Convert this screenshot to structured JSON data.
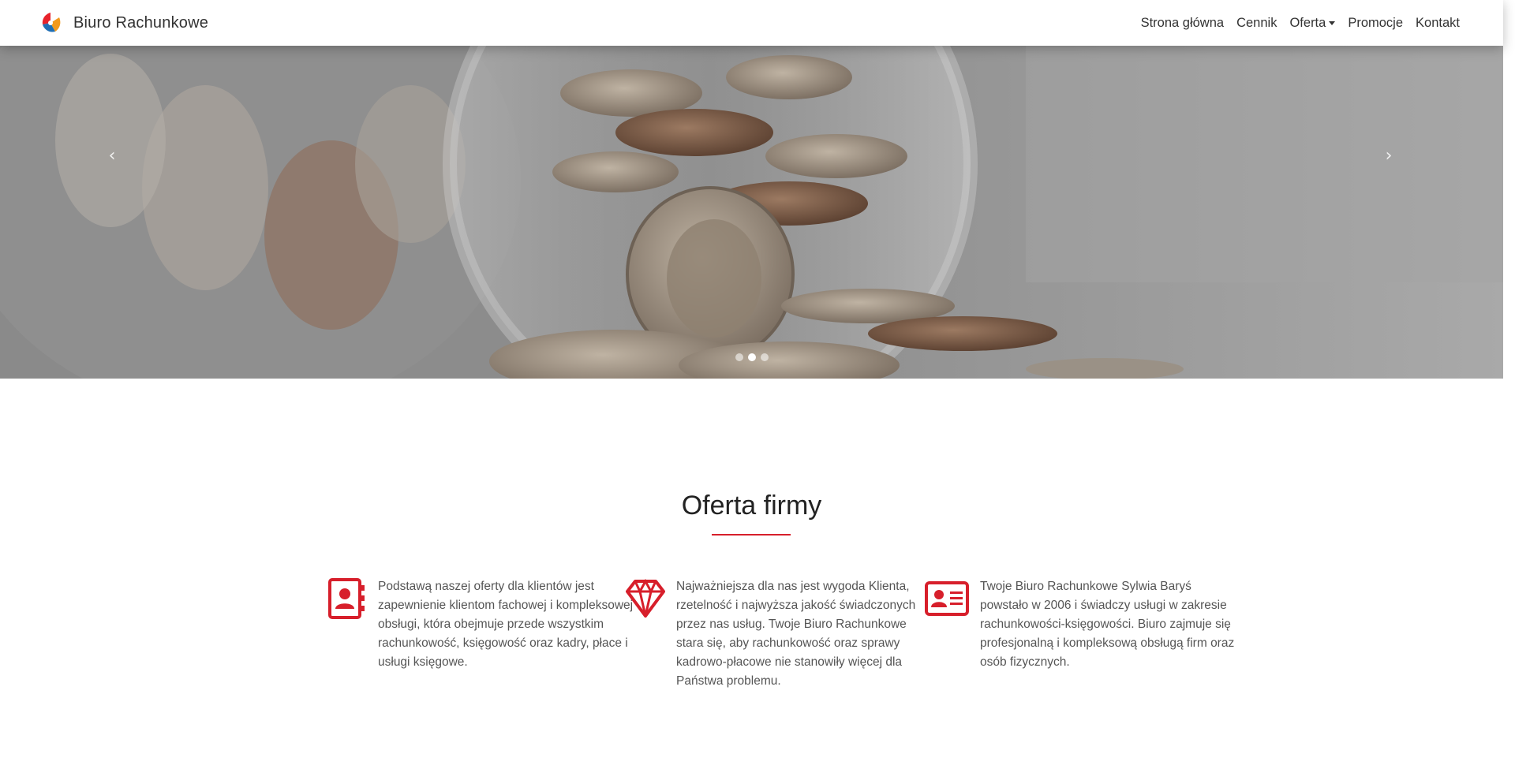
{
  "brand": {
    "name": "Biuro Rachunkowe",
    "logo_icon": "swirl-logo-icon",
    "colors": {
      "red": "#e8232b",
      "blue": "#1f6fb5",
      "orange": "#f39a1c"
    }
  },
  "nav": {
    "items": [
      {
        "label": "Strona główna"
      },
      {
        "label": "Cennik"
      },
      {
        "label": "Oferta",
        "has_dropdown": true
      },
      {
        "label": "Promocje"
      },
      {
        "label": "Kontakt"
      }
    ]
  },
  "carousel": {
    "prev_icon": "chevron-left-icon",
    "next_icon": "chevron-right-icon",
    "prev_glyph": "‹",
    "next_glyph": "›",
    "slides_count": 3,
    "active_index": 1
  },
  "offer": {
    "title": "Oferta firmy",
    "accent": "#d71f2b",
    "features": [
      {
        "icon": "address-book-icon",
        "text": "Podstawą naszej oferty dla klientów jest zapewnienie klientom fachowej i kompleksowej obsługi, która obejmuje przede wszystkim rachunkowość, księgowość oraz kadry, płace i usługi księgowe."
      },
      {
        "icon": "diamond-icon",
        "text": "Najważniejsza dla nas jest wygoda Klienta, rzetelność i najwyższa jakość świadczonych przez nas usług. Twoje Biuro Rachunkowe stara się, aby rachunkowość oraz sprawy kadrowo-płacowe nie stanowiły więcej dla Państwa problemu."
      },
      {
        "icon": "id-card-icon",
        "text": "Twoje Biuro Rachunkowe Sylwia Baryś powstało w 2006 i świadczy usługi w zakresie rachunkowości-księgowości. Biuro zajmuje się profesjonalną i kompleksową obsługą firm oraz osób fizycznych."
      }
    ]
  }
}
